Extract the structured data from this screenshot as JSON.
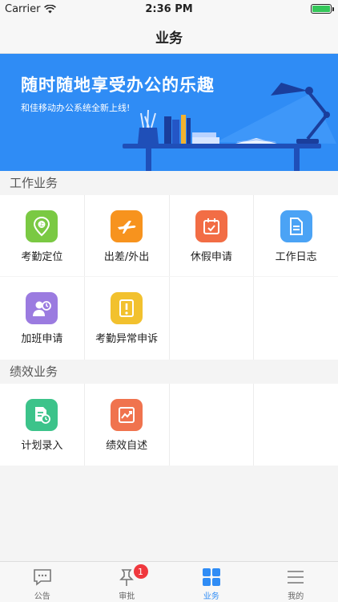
{
  "status_bar": {
    "carrier": "Carrier",
    "time": "2:36 PM"
  },
  "nav": {
    "title": "业务"
  },
  "banner": {
    "title": "随时随地享受办公的乐趣",
    "subtitle": "和佳移动办公系统全新上线!"
  },
  "sections": [
    {
      "title": "工作业务",
      "items": [
        {
          "label": "考勤定位",
          "icon": "location-icon",
          "color": "#7ac943"
        },
        {
          "label": "出差/外出",
          "icon": "airplane-icon",
          "color": "#f7931e"
        },
        {
          "label": "休假申请",
          "icon": "calendar-check-icon",
          "color": "#f26d45"
        },
        {
          "label": "工作日志",
          "icon": "document-icon",
          "color": "#4ba3f5"
        },
        {
          "label": "加班申请",
          "icon": "user-clock-icon",
          "color": "#9b7be0"
        },
        {
          "label": "考勤异常申诉",
          "icon": "exclamation-icon",
          "color": "#f2c12e"
        }
      ]
    },
    {
      "title": "绩效业务",
      "items": [
        {
          "label": "计划录入",
          "icon": "plan-entry-icon",
          "color": "#3cc38a"
        },
        {
          "label": "绩效自述",
          "icon": "chart-icon",
          "color": "#f0734e"
        }
      ]
    }
  ],
  "tabs": [
    {
      "label": "公告",
      "icon": "chat-bubble-icon"
    },
    {
      "label": "审批",
      "icon": "pin-icon",
      "badge": "1"
    },
    {
      "label": "业务",
      "icon": "grid-icon",
      "active": true
    },
    {
      "label": "我的",
      "icon": "menu-icon"
    }
  ]
}
